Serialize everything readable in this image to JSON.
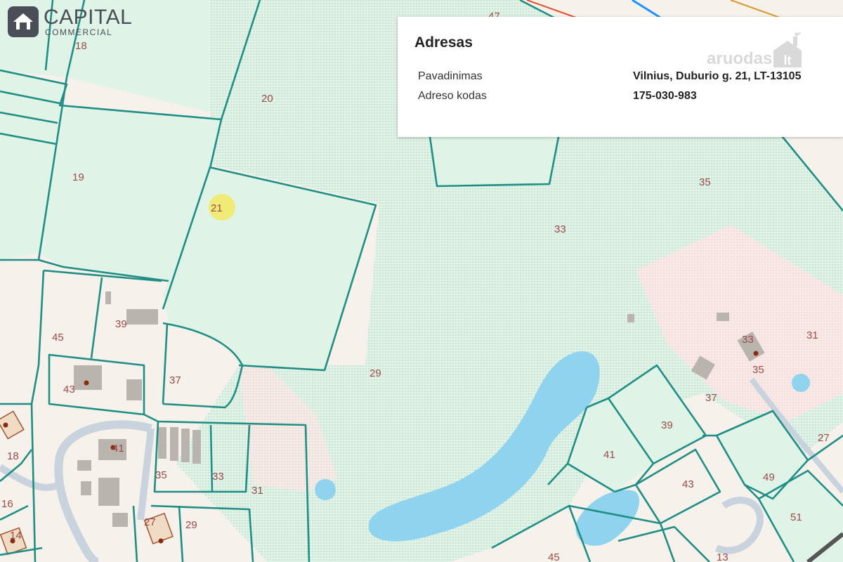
{
  "brand": {
    "name": "CAPITAL",
    "sub": "COMMERCIAL",
    "icon": "house-in-rounded-square-icon"
  },
  "popup": {
    "title": "Adresas",
    "rows": [
      {
        "label": "Pavadinimas",
        "value": "Vilnius, Duburio g. 21, LT-13105"
      },
      {
        "label": "Adreso kodas",
        "value": "175-030-983"
      }
    ],
    "watermark": {
      "text": "aruodas",
      "suffix": "lt",
      "icon": "house-chimney-icon"
    }
  },
  "map": {
    "colors": {
      "parcel_border": "#1f8f85",
      "parcel_fill": "#dff3e6",
      "land": "#f6f1ea",
      "water": "#8fd3ee",
      "selection": "#f2ea6a",
      "label": "#9b4a4a"
    },
    "plot_numbers": [
      "47",
      "18",
      "20",
      "19",
      "21",
      "35",
      "33",
      "45",
      "39",
      "37",
      "43",
      "29",
      "33",
      "35",
      "31",
      "37",
      "41",
      "39",
      "18",
      "41",
      "35",
      "33",
      "31",
      "27",
      "43",
      "49",
      "16",
      "14",
      "27",
      "29",
      "51",
      "45",
      "13"
    ]
  }
}
